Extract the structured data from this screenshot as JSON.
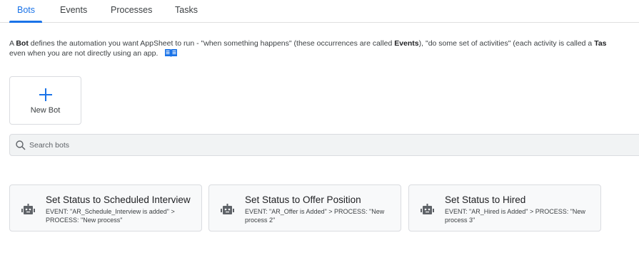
{
  "tabs": [
    {
      "label": "Bots",
      "active": true
    },
    {
      "label": "Events",
      "active": false
    },
    {
      "label": "Processes",
      "active": false
    },
    {
      "label": "Tasks",
      "active": false
    }
  ],
  "description": {
    "part1": "A ",
    "bold1": "Bot",
    "part2": " defines the automation you want AppSheet to run - \"when something happens\" (these occurrences are called ",
    "bold2": "Events",
    "part3": "), \"do some set of activities\" (each activity is called a ",
    "bold3": "Tas",
    "line2": "even when you are not directly using an app.",
    "help_icon": "book-icon"
  },
  "new_bot": {
    "label": "New Bot",
    "icon": "plus-icon"
  },
  "search": {
    "placeholder": "Search bots",
    "value": ""
  },
  "bots": [
    {
      "title": "Set Status to Scheduled Interview",
      "detail": "EVENT: \"AR_Schedule_Interview is added\" > PROCESS: \"New process\"",
      "icon": "robot-icon"
    },
    {
      "title": "Set Status to Offer Position",
      "detail": "EVENT: \"AR_Offer is Added\" > PROCESS: \"New process 2\"",
      "icon": "robot-icon"
    },
    {
      "title": "Set Status to Hired",
      "detail": "EVENT: \"AR_Hired is Added\" > PROCESS: \"New process 3\"",
      "icon": "robot-icon"
    }
  ],
  "colors": {
    "accent": "#1a73e8",
    "card_bg": "#f8f9fa",
    "icon": "#5f6368"
  }
}
